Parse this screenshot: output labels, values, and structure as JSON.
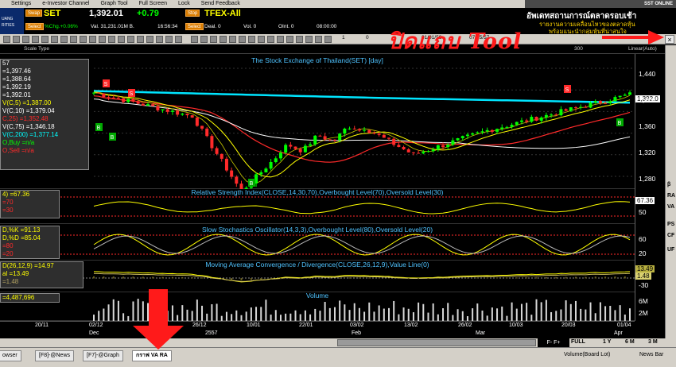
{
  "menu": [
    "Settings",
    "e-Investor Channel",
    "Graph Tool",
    "Full Screen",
    "Lock",
    "Send Feedback"
  ],
  "logo_text": "UANG\nRITIES",
  "ticker": {
    "swap1": "Swap",
    "symbol": "SET",
    "price": "1,392.01",
    "change": "+0.79",
    "select1": "Select",
    "pct_chg": "%Chg.+0.06%",
    "value": "Val. 31,231.01M B.",
    "time": "16:56:34",
    "stop": "Stop",
    "fut_symbol": "TFEX-All",
    "select2": "Select",
    "deal": "Deal. 0",
    "vol": "Vol. 0",
    "oint": "OInt. 0",
    "fut_time": "08:00:00"
  },
  "banner": {
    "top_label": "SST   ONLINE",
    "line1": "อัพเดทสถานการณ์ตลาดรอบเช้า",
    "line2": "รายงานความเคลื่อนไหวของตลาดหุ้น",
    "line3": "พร้อมแนะนำกลุ่มหุ้นที่น่าสนใจ"
  },
  "toolbar": {
    "items": [
      "1",
      "0",
      "01/01/56",
      "07/05/57"
    ],
    "scale_label": "Scale Type",
    "linear": "Linear(Auto)",
    "fields": [
      "300"
    ]
  },
  "annotation": "ปิดแถบ Tool",
  "close_button": "×",
  "price_pane": {
    "title": "The Stock Exchange of Thailand(SET) [day]",
    "legend": [
      {
        "t": "57",
        "c": "#ffffff"
      },
      {
        "t": "=1,397.46",
        "c": "#ffffff"
      },
      {
        "t": "=1,388.64",
        "c": "#ffffff"
      },
      {
        "t": "=1,392.19",
        "c": "#ffffff"
      },
      {
        "t": "=1,392.01",
        "c": "#ffffff"
      },
      {
        "t": "V(C,5)  =1,387.00",
        "c": "#ffff00"
      },
      {
        "t": "V(C,10)  =1,379.04",
        "c": "#ffffff"
      },
      {
        "t": "C,25)  =1,352.48",
        "c": "#ff2a2a"
      },
      {
        "t": "V(C,75)  =1,346.18",
        "c": "#ffffff"
      },
      {
        "t": "V(C,200)  =1,377.14",
        "c": "#00ffff"
      },
      {
        "t": "O,Buy  =n/a",
        "c": "#00ff00"
      },
      {
        "t": "O,Sell  =n/a",
        "c": "#ff2a2a"
      }
    ],
    "axis": [
      "1,440",
      "1,400",
      "1,360",
      "1,320",
      "1,280",
      "1,240",
      "1,200"
    ],
    "axis_flag": "1,392.0"
  },
  "rsi_pane": {
    "title": "Relative Strength Index(CLOSE,14,30,70),Overbought Level(70),Oversold Level(30)",
    "legend": [
      "4)  =67.36",
      "=70",
      "=30"
    ],
    "axis_flag": "67.36",
    "axis": [
      "50"
    ]
  },
  "sto_pane": {
    "title": "Slow Stochastics Oscillator(14,3,3),Overbought Level(80),Oversold Level(20)",
    "legend": [
      "D,%K  =91.13",
      "D,%D  =85.04",
      "=80",
      "=20"
    ],
    "axis": [
      "60",
      "20"
    ]
  },
  "macd_pane": {
    "title": "Moving Average Convergence / Divergence(CLOSE,26,12,9),Value Line(0)",
    "legend": [
      "D(26,12,9)  =14.97",
      "al  =13.49",
      "=1.48"
    ],
    "axis": [
      "13.49",
      "1.48",
      "-30"
    ]
  },
  "vol_pane": {
    "title": "Volume",
    "legend": [
      "=4,487,696"
    ],
    "axis": [
      "6M",
      "4M",
      "2M"
    ]
  },
  "dates": {
    "top": [
      "20/11",
      "02/12",
      "26/12",
      "10/01",
      "22/01",
      "03/02",
      "13/02",
      "26/02",
      "10/03",
      "20/03",
      "01/04"
    ],
    "bottom": [
      "Dec",
      "2557",
      "Feb",
      "Mar",
      "Apr"
    ]
  },
  "range_buttons": [
    "FULL",
    "1 Y",
    "6 M",
    "3 M"
  ],
  "tabs": [
    "owser",
    "[F8]-@News",
    "[F7]-@Graph",
    "กราฟ VA RA"
  ],
  "status": [
    "Volume(Board Lot)",
    "News Bar"
  ],
  "right_strip": [
    "β",
    "RA",
    "VA",
    "PS",
    "CF",
    "UF"
  ],
  "colors": {
    "cyan": "#00e5ff",
    "red": "#ff2a2a",
    "yellow": "#ffff00",
    "green": "#00ff00",
    "title": "#4fc3ff"
  }
}
